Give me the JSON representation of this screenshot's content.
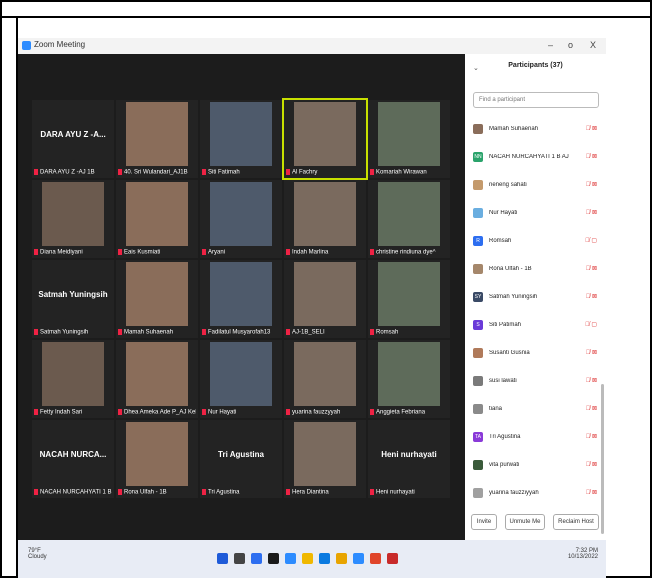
{
  "window": {
    "title": "Zoom Meeting",
    "controls": [
      "–",
      "o",
      "X"
    ]
  },
  "gallery": {
    "tiles": [
      {
        "caption": "DARA AYU Z -AJ 1B",
        "bigname": "DARA AYU Z -A...",
        "name_only": true
      },
      {
        "caption": "40. Sri Wulandari_AJ1B",
        "name_only": false
      },
      {
        "caption": "Siti Fatimah",
        "name_only": false
      },
      {
        "caption": "Al Fachry",
        "name_only": false,
        "active": true
      },
      {
        "caption": "Komariah Wirawan",
        "name_only": false
      },
      {
        "caption": "Diana Meidiyani",
        "name_only": false
      },
      {
        "caption": "Eais Kusmiati",
        "name_only": false
      },
      {
        "caption": "Aryani",
        "name_only": false
      },
      {
        "caption": "Indah Marlina",
        "name_only": false
      },
      {
        "caption": "christine rindiuna dye^",
        "name_only": false
      },
      {
        "caption": "Satmah Yuningsih",
        "bigname": "Satmah Yuningsih",
        "name_only": true
      },
      {
        "caption": "Mamah Suhaenah",
        "name_only": false
      },
      {
        "caption": "Fadilatul Musyarofah13",
        "name_only": false
      },
      {
        "caption": "AJ-1B_SELI",
        "name_only": false
      },
      {
        "caption": "Romsah",
        "name_only": false
      },
      {
        "caption": "Fetty Indah Sari",
        "name_only": false
      },
      {
        "caption": "Dhea Ameka Ade P_AJ Keb",
        "name_only": false
      },
      {
        "caption": "Nur Hayati",
        "name_only": false
      },
      {
        "caption": "yuarina fauzzyyah",
        "name_only": false
      },
      {
        "caption": "Anggieta Febriana",
        "name_only": false
      },
      {
        "caption": "NACAH NURCAHYATI 1 B AJ",
        "bigname": "NACAH NURCA...",
        "name_only": true
      },
      {
        "caption": "Rona Ulfah - 1B",
        "name_only": false
      },
      {
        "caption": "Tri Agustina",
        "bigname": "Tri Agustina",
        "name_only": true
      },
      {
        "caption": "Hera Diantina",
        "name_only": false
      },
      {
        "caption": "Heni nurhayati",
        "bigname": "Heni nurhayati",
        "name_only": true
      }
    ]
  },
  "participants": {
    "title": "Participants (37)",
    "search_placeholder": "Find a participant",
    "list": [
      {
        "name": "Mamah Suhaenah",
        "initials": "",
        "color": "#8a6d5a",
        "status": "🎙̸ ⊠"
      },
      {
        "name": "NACAH NURCAHYATI 1 B AJ",
        "initials": "NN",
        "color": "#2aa36b",
        "status": "🎙̸ ⊠"
      },
      {
        "name": "neneng sahati",
        "initials": "",
        "color": "#c49a6c",
        "status": "🎙̸ ⊠"
      },
      {
        "name": "Nur Hayati",
        "initials": "",
        "color": "#6aaee0",
        "status": "🎙̸ ⊠"
      },
      {
        "name": "Romsah",
        "initials": "R",
        "color": "#2d6ef0",
        "status": "🎙̸ ▢"
      },
      {
        "name": "Rona Ulfah - 1B",
        "initials": "",
        "color": "#a5876b",
        "status": "🎙̸ ⊠"
      },
      {
        "name": "Satmah Yuningsih",
        "initials": "SY",
        "color": "#3a4a66",
        "status": "🎙̸ ⊠"
      },
      {
        "name": "Siti Patimah",
        "initials": "S",
        "color": "#6a3ad8",
        "status": "🎙̸ ▢"
      },
      {
        "name": "Susanti Gusnia",
        "initials": "",
        "color": "#b07a5a",
        "status": "🎙̸ ⊠"
      },
      {
        "name": "susi lawati",
        "initials": "",
        "color": "#7a7a7a",
        "status": "🎙̸ ⊠"
      },
      {
        "name": "tiana",
        "initials": "",
        "color": "#8a8a8a",
        "status": "🎙̸ ⊠"
      },
      {
        "name": "Tri Agustina",
        "initials": "TA",
        "color": "#8a3ad8",
        "status": "🎙̸ ⊠"
      },
      {
        "name": "vita purwati",
        "initials": "",
        "color": "#3a5a3a",
        "status": "🎙̸ ⊠"
      },
      {
        "name": "yuarina fauzziyyah",
        "initials": "",
        "color": "#a0a0a0",
        "status": "🎙̸ ⊠"
      }
    ],
    "buttons": {
      "invite": "Invite",
      "unmute": "Unmute Me",
      "reclaim": "Reclaim Host"
    }
  },
  "taskbar": {
    "temp": "79°F",
    "weather": "Cloudy",
    "time": "7:32 PM",
    "date": "10/13/2022",
    "apps": [
      "#1e5ad8",
      "#444444",
      "#2d6ef0",
      "#1a1a1a",
      "#2d8cff",
      "#f0b800",
      "#0a7ae0",
      "#e8a400",
      "#2d8cff",
      "#e0452a",
      "#c82a2a"
    ]
  }
}
